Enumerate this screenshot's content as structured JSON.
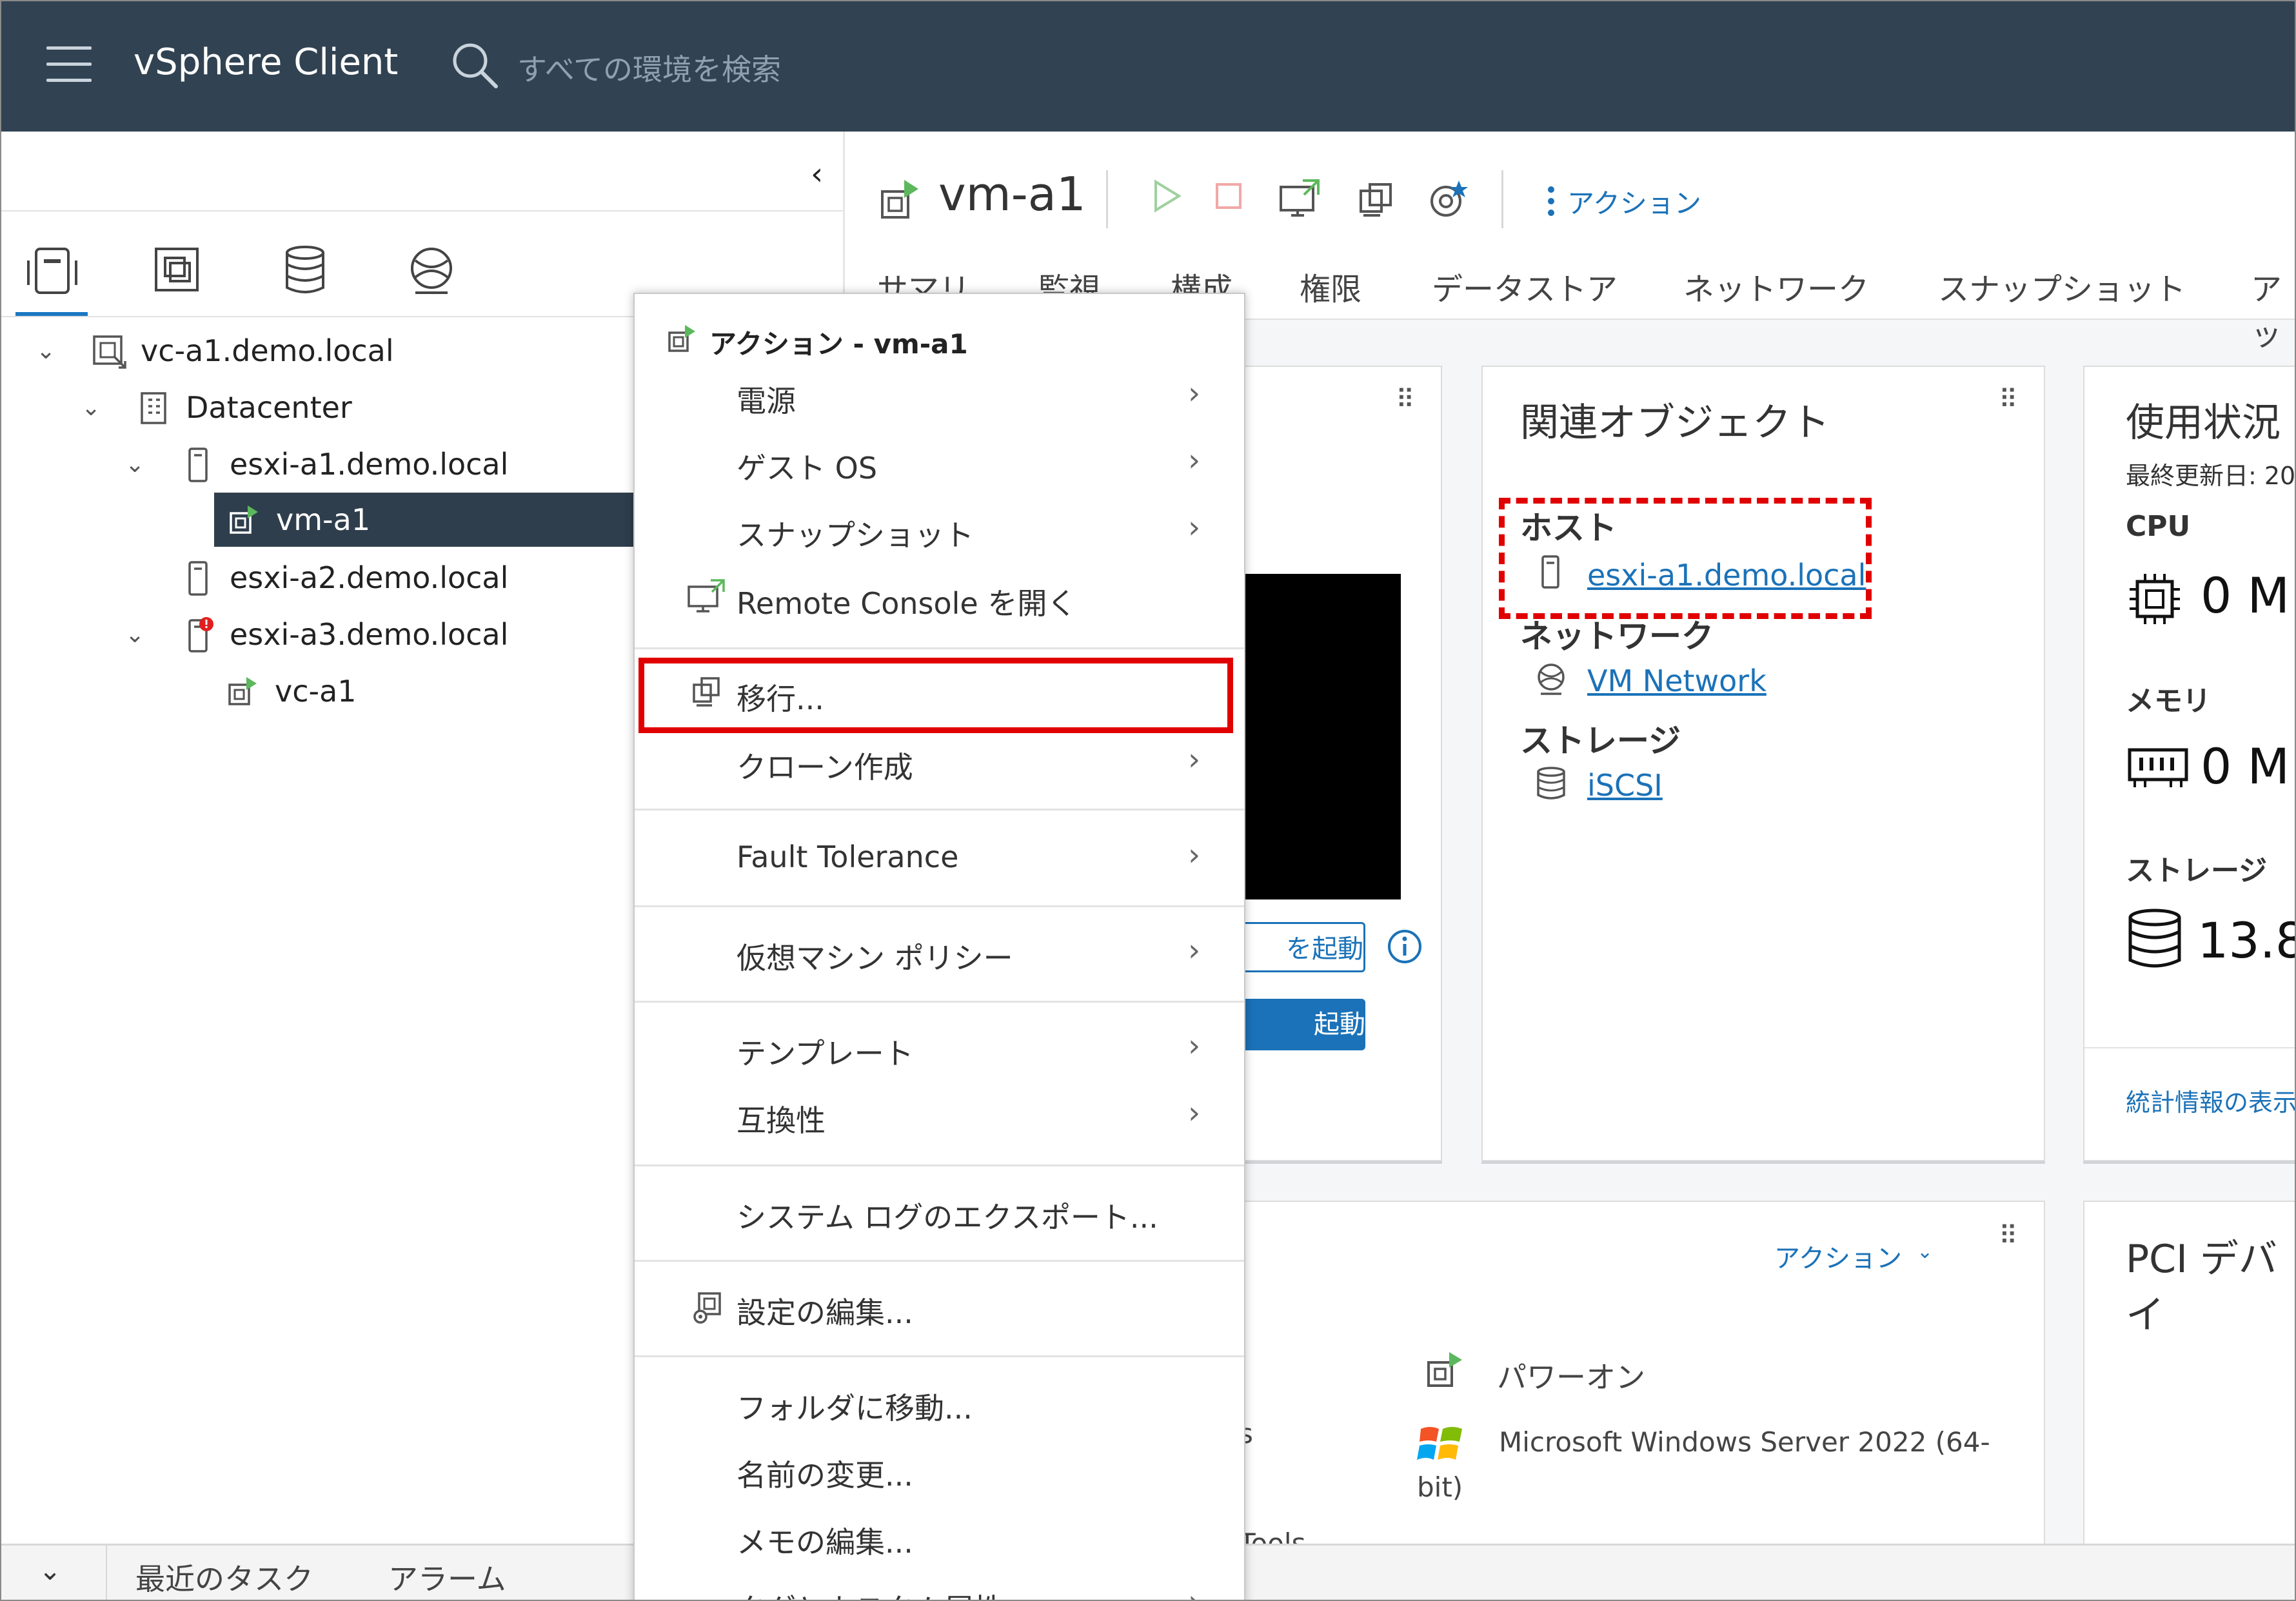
{
  "header": {
    "app_title": "vSphere Client",
    "search_placeholder": "すべての環境を検索"
  },
  "tree": [
    {
      "label": "vc-a1.demo.local"
    },
    {
      "label": "Datacenter"
    },
    {
      "label": "esxi-a1.demo.local"
    },
    {
      "label": "vm-a1"
    },
    {
      "label": "esxi-a2.demo.local"
    },
    {
      "label": "esxi-a3.demo.local"
    },
    {
      "label": "vc-a1"
    }
  ],
  "object": {
    "title": "vm-a1",
    "actions_label": "アクション",
    "tabs": [
      "サマリ",
      "監視",
      "構成",
      "権限",
      "データストア",
      "ネットワーク",
      "スナップショット",
      "アッ"
    ]
  },
  "related": {
    "title": "関連オブジェクト",
    "host_label": "ホスト",
    "host_value": "esxi-a1.demo.local",
    "network_label": "ネットワーク",
    "network_value": "VM Network",
    "storage_label": "ストレージ",
    "storage_value": "iSCSI"
  },
  "usage": {
    "title": "使用状況",
    "updated": "最終更新日: 20",
    "cpu_label": "CPU",
    "cpu_value": "0 M",
    "mem_label": "メモリ",
    "mem_value": "0 M",
    "storage_label": "ストレージ",
    "storage_value": "13.8",
    "stats_link": "統計情報の表示"
  },
  "guest": {
    "actions_label": "アクション",
    "power_state": "パワーオン",
    "os_line1": "Microsoft Windows Server 2022 (64-",
    "os_line2": "bit)",
    "partial_s": "s",
    "partial_tools": "Tools",
    "btn_launch_web": "を起動",
    "btn_launch": "起動"
  },
  "pci": {
    "title": "PCI デバイ"
  },
  "menu": {
    "header": "アクション - vm-a1",
    "items": [
      {
        "label": "電源"
      },
      {
        "label": "ゲスト OS"
      },
      {
        "label": "スナップショット"
      },
      {
        "label": "Remote Console を開く"
      },
      {
        "label": "移行..."
      },
      {
        "label": "クローン作成"
      },
      {
        "label": "Fault Tolerance"
      },
      {
        "label": "仮想マシン ポリシー"
      },
      {
        "label": "テンプレート"
      },
      {
        "label": "互換性"
      },
      {
        "label": "システム ログのエクスポート..."
      },
      {
        "label": "設定の編集..."
      },
      {
        "label": "フォルダに移動..."
      },
      {
        "label": "名前の変更..."
      },
      {
        "label": "メモの編集..."
      },
      {
        "label": "タグとカスタム属性"
      }
    ]
  },
  "bottom": {
    "recent_tasks": "最近のタスク",
    "alarms": "アラーム"
  },
  "colors": {
    "header_bg": "#314352",
    "accent": "#1b72b8",
    "highlight": "#e00000"
  }
}
